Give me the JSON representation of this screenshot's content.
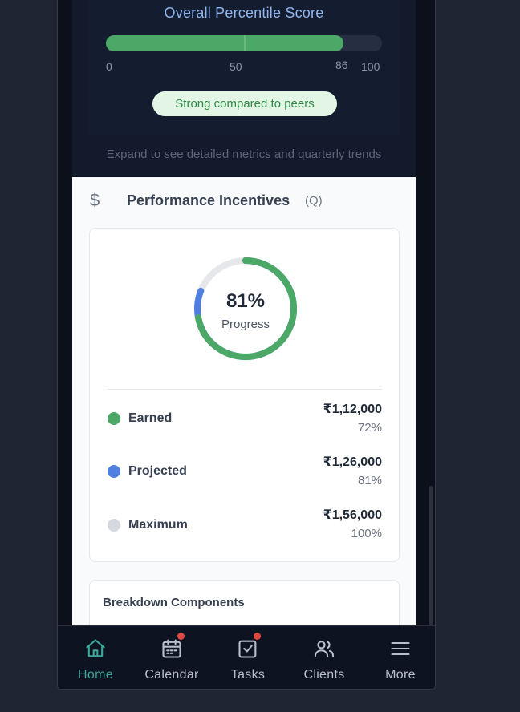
{
  "percentile": {
    "title": "Overall Percentile Score",
    "value": 86,
    "median_marker": 50,
    "scale": {
      "min": "0",
      "mid": "50",
      "max": "100"
    },
    "value_label": "86",
    "badge": "Strong compared to peers",
    "expand_hint": "Expand to see detailed metrics and quarterly trends",
    "color": "#4ca866"
  },
  "incentives": {
    "icon": "dollar-icon",
    "title": "Performance Incentives",
    "period": "(Q)",
    "ring": {
      "percent_label": "81%",
      "label": "Progress",
      "earned_fraction": 0.72,
      "projected_fraction": 0.81
    },
    "rows": [
      {
        "label": "Earned",
        "amount": "₹1,12,000",
        "pct": "72%",
        "color": "#4ca866"
      },
      {
        "label": "Projected",
        "amount": "₹1,26,000",
        "pct": "81%",
        "color": "#4f7fe0"
      },
      {
        "label": "Maximum",
        "amount": "₹1,56,000",
        "pct": "100%",
        "color": "#d5d8de"
      }
    ],
    "breakdown_title": "Breakdown Components"
  },
  "nav": {
    "items": [
      {
        "label": "Home",
        "icon": "home-icon",
        "active": true,
        "badge": false
      },
      {
        "label": "Calendar",
        "icon": "calendar-icon",
        "active": false,
        "badge": true
      },
      {
        "label": "Tasks",
        "icon": "tasks-icon",
        "active": false,
        "badge": true
      },
      {
        "label": "Clients",
        "icon": "clients-icon",
        "active": false,
        "badge": false
      },
      {
        "label": "More",
        "icon": "menu-icon",
        "active": false,
        "badge": false
      }
    ],
    "active_color": "#3aa89a",
    "badge_color": "#e0473f"
  }
}
